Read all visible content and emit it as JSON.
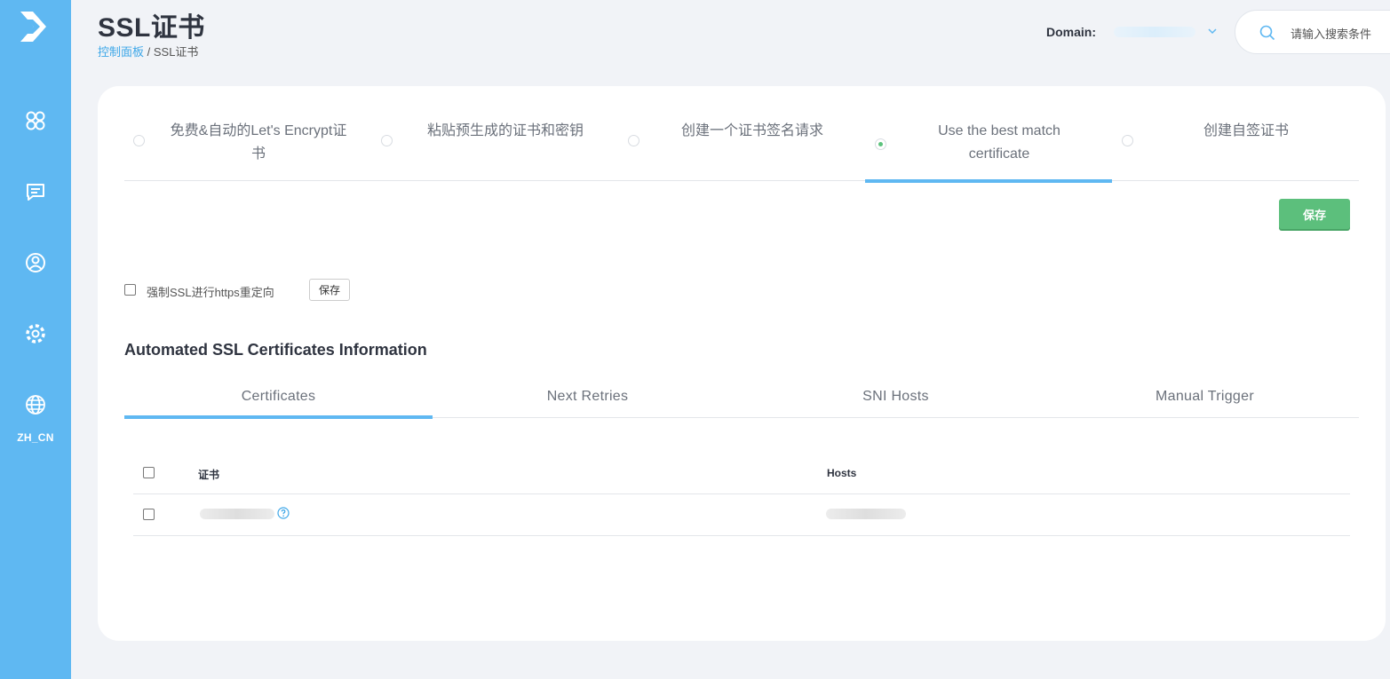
{
  "sidebar": {
    "items": [
      {
        "icon": "apps-grid-icon"
      },
      {
        "icon": "message-icon"
      },
      {
        "icon": "user-circle-icon"
      },
      {
        "icon": "settings-gear-icon"
      },
      {
        "icon": "globe-icon",
        "label": "ZH_CN"
      }
    ]
  },
  "header": {
    "title": "SSL证书",
    "breadcrumb": {
      "link": "控制面板",
      "separator": " / ",
      "current": "SSL证书"
    },
    "domain_label": "Domain:",
    "search_placeholder": "请输入搜索条件"
  },
  "cert_options": [
    {
      "label_line1": "免费&自动的Let's Encrypt证",
      "label_line2": "书",
      "checked": false
    },
    {
      "label_line1": "粘贴预生成的证书和密钥",
      "label_line2": "",
      "checked": false
    },
    {
      "label_line1": "创建一个证书签名请求",
      "label_line2": "",
      "checked": false
    },
    {
      "label_line1": "Use the best match",
      "label_line2": "certificate",
      "checked": true
    },
    {
      "label_line1": "创建自签证书",
      "label_line2": "",
      "checked": false
    }
  ],
  "save_button": "保存",
  "force_ssl": {
    "label": "强制SSL进行https重定向",
    "button": "保存",
    "checked": false
  },
  "section_title": "Automated SSL Certificates Information",
  "tabs": [
    {
      "label": "Certificates",
      "active": true
    },
    {
      "label": "Next Retries",
      "active": false
    },
    {
      "label": "SNI Hosts",
      "active": false
    },
    {
      "label": "Manual Trigger",
      "active": false
    }
  ],
  "table": {
    "columns": [
      "证书",
      "Hosts"
    ],
    "rows": [
      {
        "certificate": "",
        "hosts": ""
      }
    ]
  },
  "colors": {
    "sidebar": "#5fb8f2",
    "accent": "#5fb8f2",
    "save_green": "#5cbf7c",
    "link": "#3ea7e8"
  }
}
